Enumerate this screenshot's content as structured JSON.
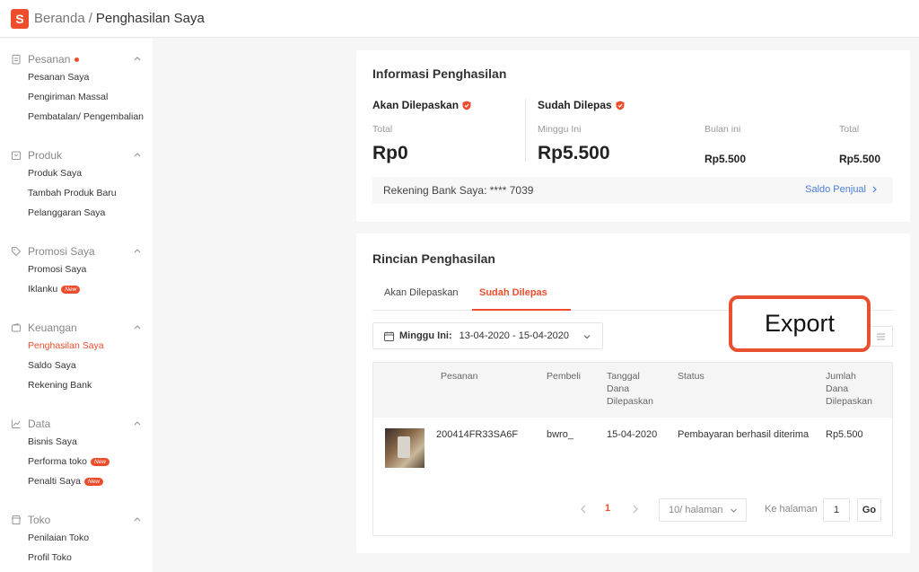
{
  "breadcrumb": {
    "home": "Beranda",
    "separator": "/",
    "current": "Penghasilan Saya"
  },
  "logo_letter": "S",
  "sidebar": {
    "sections": [
      {
        "title": "Pesanan",
        "icon": "clipboard-icon",
        "dot": true,
        "items": [
          "Pesanan Saya",
          "Pengiriman Massal",
          "Pembatalan/ Pengembalian"
        ]
      },
      {
        "title": "Produk",
        "icon": "box-icon",
        "items": [
          "Produk Saya",
          "Tambah Produk Baru",
          "Pelanggaran Saya"
        ]
      },
      {
        "title": "Promosi Saya",
        "icon": "tag-icon",
        "items": [
          "Promosi Saya",
          "Iklanku"
        ]
      },
      {
        "title": "Keuangan",
        "icon": "wallet-icon",
        "items": [
          "Penghasilan Saya",
          "Saldo Saya",
          "Rekening Bank"
        ]
      },
      {
        "title": "Data",
        "icon": "chart-icon",
        "items": [
          "Bisnis Saya",
          "Performa toko",
          "Penalti Saya"
        ]
      },
      {
        "title": "Toko",
        "icon": "store-icon",
        "items": [
          "Penilaian Toko",
          "Profil Toko"
        ]
      }
    ],
    "badge_label": "New",
    "active_item": "Penghasilan Saya"
  },
  "income_info": {
    "title": "Informasi Penghasilan",
    "pending": {
      "label": "Akan Dilepaskan",
      "total_label": "Total",
      "total_value": "Rp0"
    },
    "released": {
      "label": "Sudah Dilepas",
      "week_label": "Minggu Ini",
      "week_value": "Rp5.500",
      "month_label": "Bulan ini",
      "month_value": "Rp5.500",
      "total_label": "Total",
      "total_value": "Rp5.500"
    },
    "bank_account": "Rekening Bank Saya: **** 7039",
    "seller_balance_link": "Saldo Penjual"
  },
  "income_detail": {
    "title": "Rincian Penghasilan",
    "tabs": [
      "Akan Dilepaskan",
      "Sudah Dilepas"
    ],
    "active_tab": "Sudah Dilepas",
    "date_filter": {
      "label": "Minggu Ini:",
      "range": "13-04-2020 - 15-04-2020"
    },
    "export_label": "Export",
    "columns": [
      "Pesanan",
      "Pembeli",
      "Tanggal\nDana\nDilepaskan",
      "Status",
      "Jumlah\nDana\nDilepaskan"
    ],
    "rows": [
      {
        "order": "200414FR33SA6F",
        "buyer": "bwro_",
        "date": "15-04-2020",
        "status": "Pembayaran berhasil diterima",
        "amount": "Rp5.500"
      }
    ],
    "pagination": {
      "current_page": "1",
      "per_page": "10/ halaman",
      "goto_label": "Ke halaman",
      "goto_value": "1",
      "go_label": "Go"
    }
  },
  "colors": {
    "brand": "#ee4d2d",
    "link": "#4a7fd8",
    "highlight_border": "#e8502f"
  }
}
